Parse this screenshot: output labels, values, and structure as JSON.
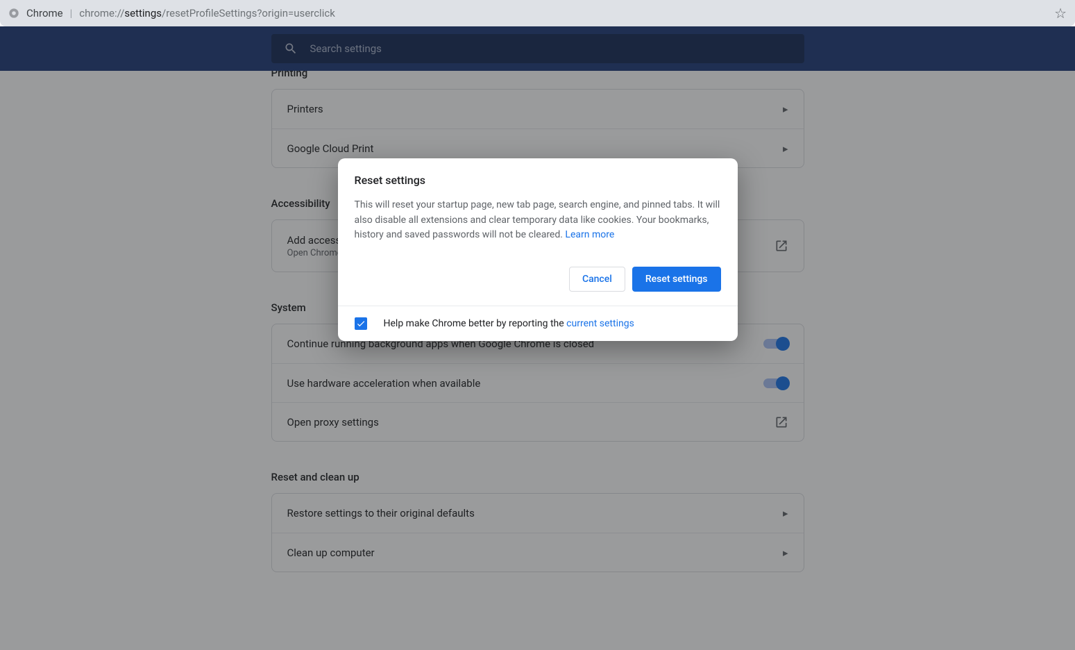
{
  "browser": {
    "title": "Chrome",
    "url_proto": "chrome://",
    "url_path_bold": "settings",
    "url_path_rest": "/resetProfileSettings?origin=userclick"
  },
  "search": {
    "placeholder": "Search settings"
  },
  "sections": {
    "printing": {
      "title": "Printing",
      "rows": [
        {
          "label": "Printers"
        },
        {
          "label": "Google Cloud Print"
        }
      ]
    },
    "accessibility": {
      "title": "Accessibility",
      "row": {
        "label": "Add accessibility features",
        "sub": "Open Chrome Web Store"
      }
    },
    "system": {
      "title": "System",
      "rows": [
        {
          "label": "Continue running background apps when Google Chrome is closed"
        },
        {
          "label": "Use hardware acceleration when available"
        },
        {
          "label": "Open proxy settings"
        }
      ]
    },
    "reset": {
      "title": "Reset and clean up",
      "rows": [
        {
          "label": "Restore settings to their original defaults"
        },
        {
          "label": "Clean up computer"
        }
      ]
    }
  },
  "dialog": {
    "title": "Reset settings",
    "body": "This will reset your startup page, new tab page, search engine, and pinned tabs. It will also disable all extensions and clear temporary data like cookies. Your bookmarks, history and saved passwords will not be cleared. ",
    "learn_more": "Learn more",
    "cancel": "Cancel",
    "confirm": "Reset settings",
    "footer_pre": "Help make Chrome better by reporting the ",
    "footer_link": "current settings"
  }
}
